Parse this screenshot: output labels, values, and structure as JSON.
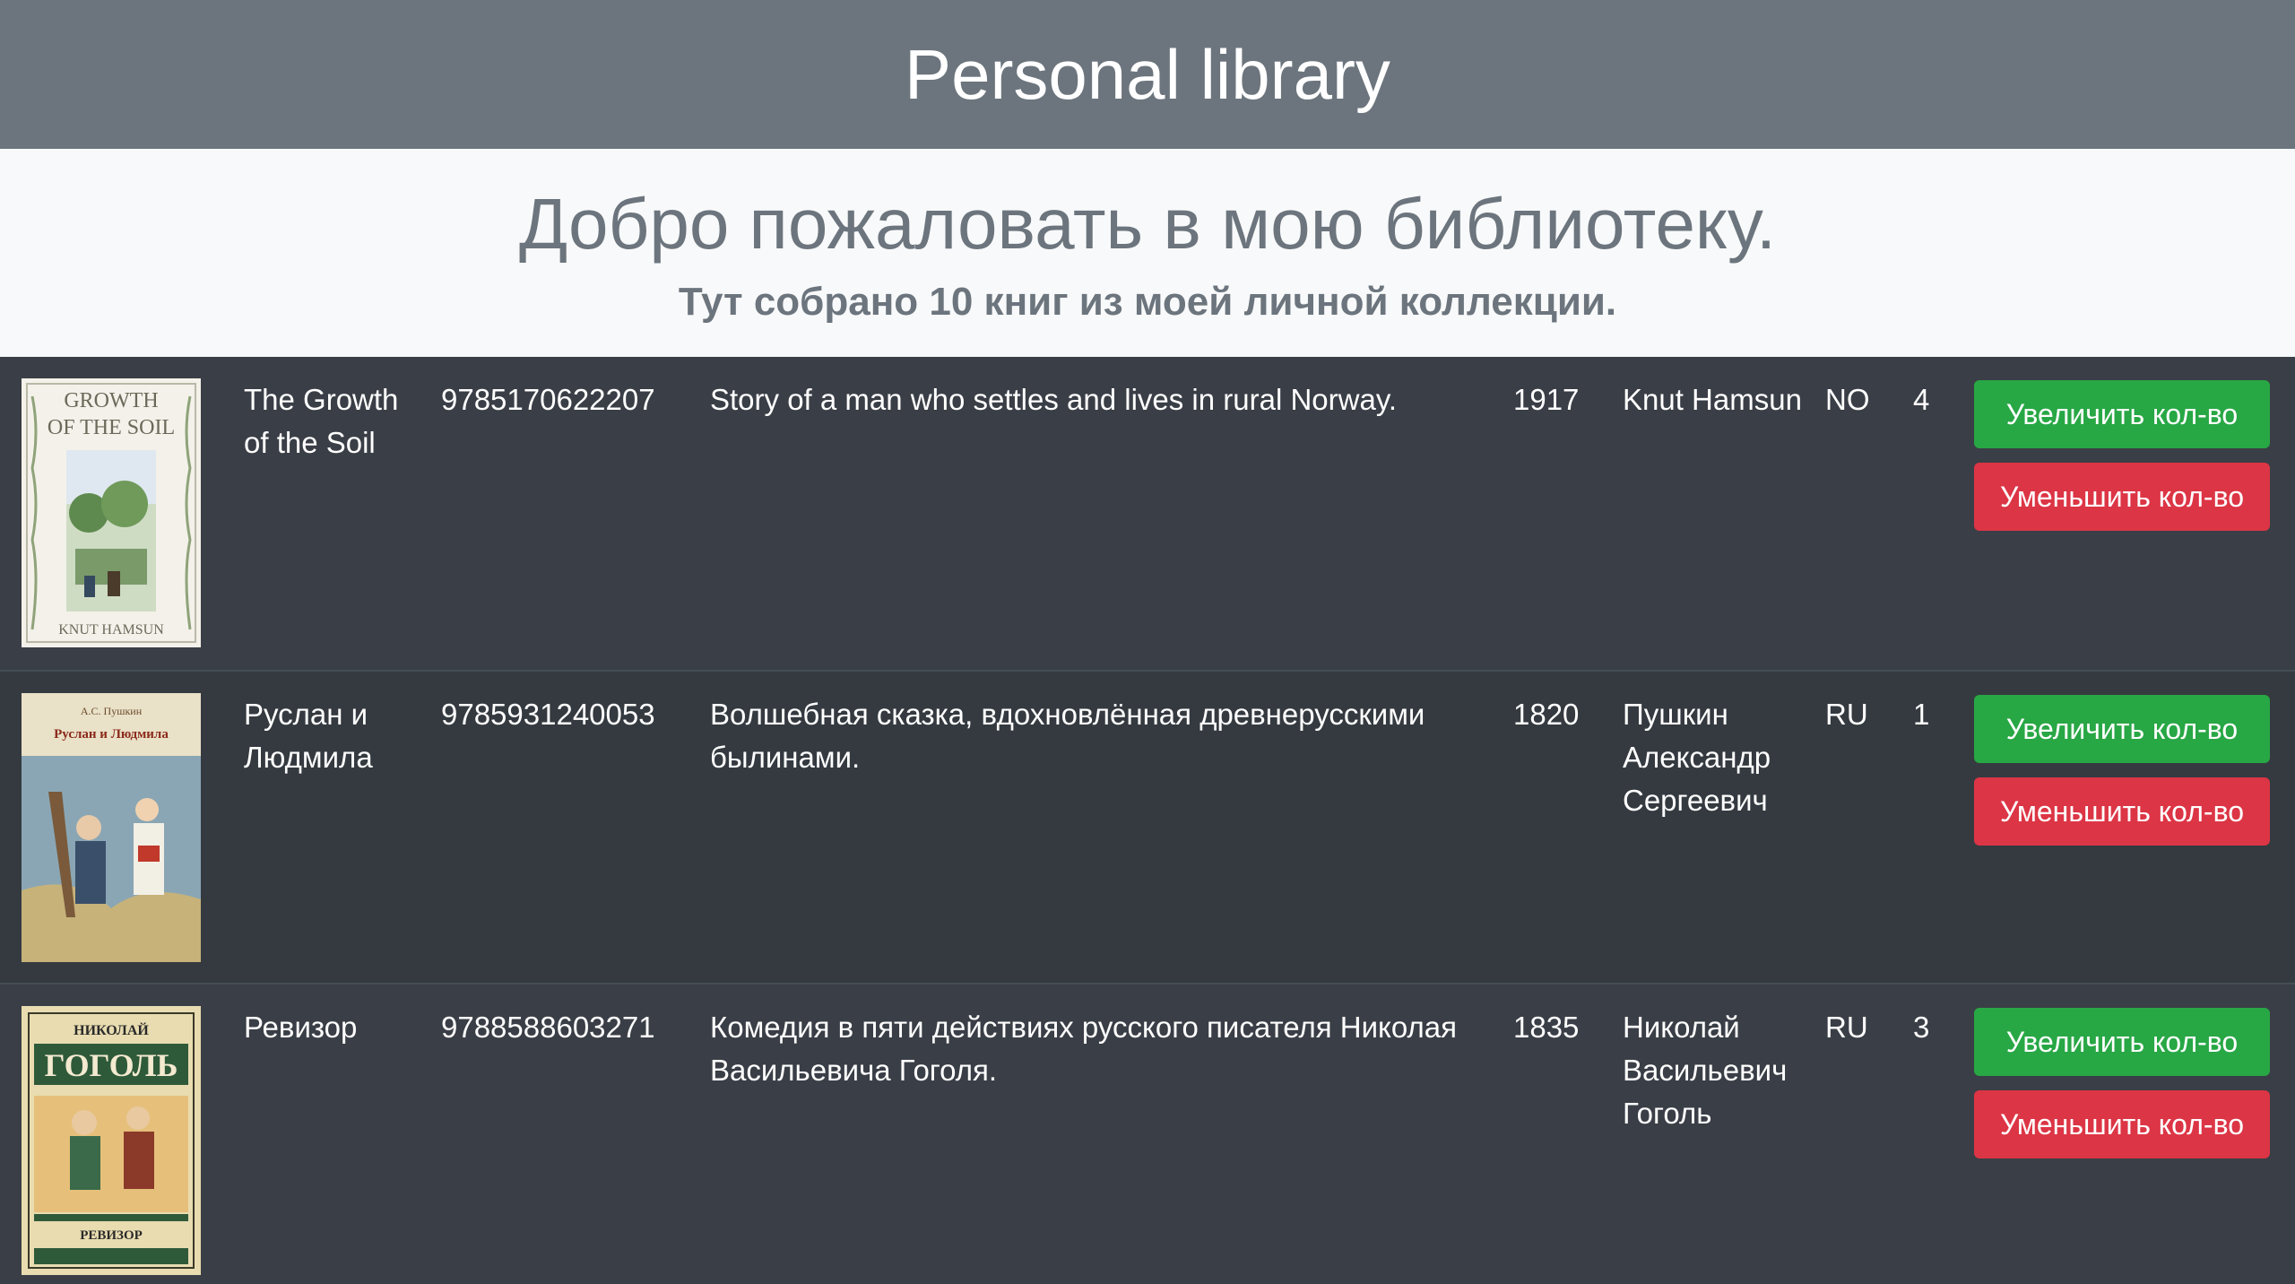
{
  "header": {
    "title": "Personal library"
  },
  "jumbotron": {
    "heading": "Добро пожаловать в мою библиотеку.",
    "subheading": "Тут собрано 10 книг из моей личной коллекции."
  },
  "buttons": {
    "increase_label": "Увеличить кол-во",
    "decrease_label": "Уменьшить кол-во"
  },
  "books": [
    {
      "title": "The Growth of the Soil",
      "isbn": "9785170622207",
      "description": "Story of a man who settles and lives in rural Norway.",
      "year": "1917",
      "author": "Knut Hamsun",
      "country": "NO",
      "quantity": "4",
      "cover": {
        "top_text": "Growth of the Soil",
        "bottom_text": "Knut Hamsun"
      }
    },
    {
      "title": "Руслан и Людмила",
      "isbn": "9785931240053",
      "description": "Волшебная сказка, вдохновлённая древнерусскими былинами.",
      "year": "1820",
      "author": "Пушкин Александр Сергеевич",
      "country": "RU",
      "quantity": "1",
      "cover": {
        "top_text": "А.С. Пушкин",
        "bottom_text": "Руслан и Людмила"
      }
    },
    {
      "title": "Ревизор",
      "isbn": "9788588603271",
      "description": "Комедия в пяти действиях русского писателя Николая Васильевича Гоголя.",
      "year": "1835",
      "author": "Николай Васильевич Гоголь",
      "country": "RU",
      "quantity": "3",
      "cover": {
        "top_text": "НИКОЛАЙ",
        "main_text": "ГОГОЛЬ",
        "bottom_text": "РЕВИЗОР"
      }
    }
  ],
  "colors": {
    "navbar": "#6c757d",
    "jumbotron": "#f8f9fa",
    "table": "#343a40",
    "success": "#28a745",
    "danger": "#dc3545"
  }
}
